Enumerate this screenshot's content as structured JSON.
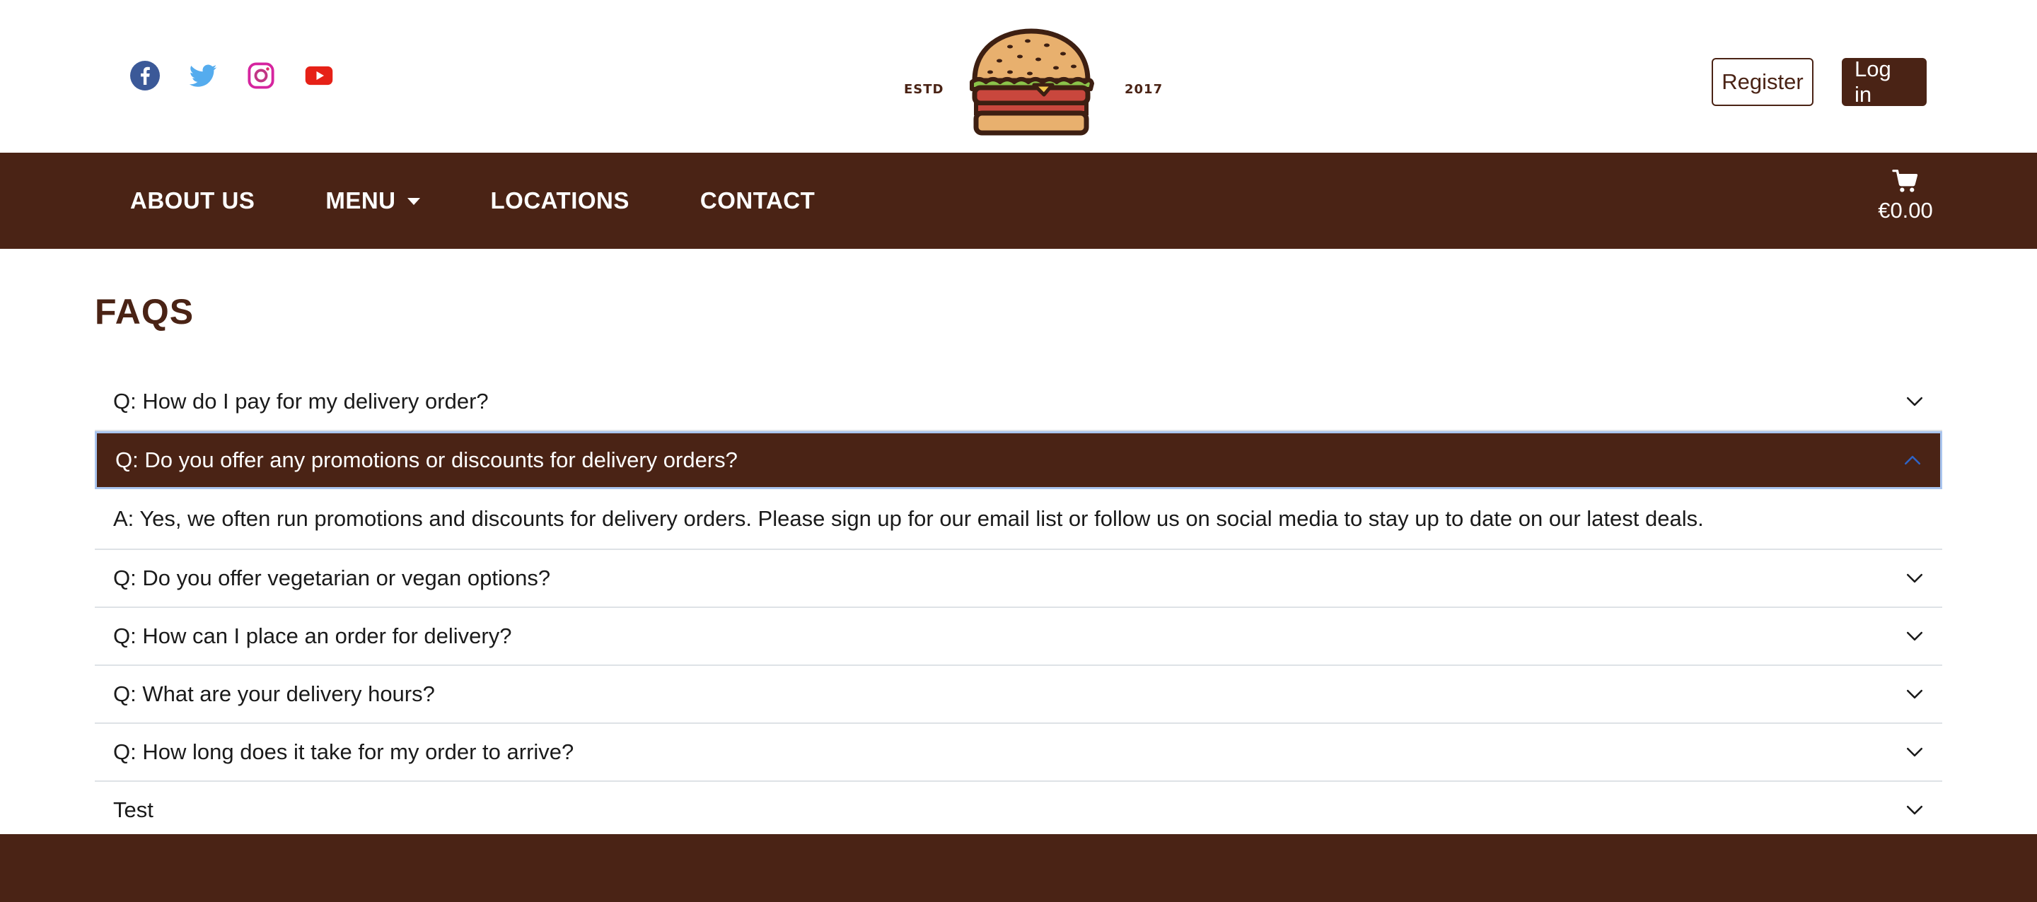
{
  "header": {
    "social": [
      {
        "icon": "facebook-icon",
        "color": "#3b5998"
      },
      {
        "icon": "twitter-icon",
        "color": "#55acee"
      },
      {
        "icon": "instagram-icon",
        "color": "#c13584"
      },
      {
        "icon": "youtube-icon",
        "color": "#e62117"
      }
    ],
    "logo": {
      "left_text": "ESTD",
      "right_text": "2017"
    },
    "register_label": "Register",
    "login_label": "Log in"
  },
  "nav": {
    "items": [
      {
        "label": "ABOUT US"
      },
      {
        "label": "MENU"
      },
      {
        "label": "LOCATIONS"
      },
      {
        "label": "CONTACT"
      }
    ],
    "cart_total": "€0.00"
  },
  "page": {
    "title": "FAQS"
  },
  "faqs": [
    {
      "q": "Q: How do I pay for my delivery order?",
      "expanded": false
    },
    {
      "q": "Q: Do you offer any promotions or discounts for delivery orders?",
      "expanded": true,
      "a": "A: Yes, we often run promotions and discounts for delivery orders. Please sign up for our email list or follow us on social media to stay up to date on our latest deals."
    },
    {
      "q": "Q: Do you offer vegetarian or vegan options?",
      "expanded": false
    },
    {
      "q": "Q: How can I place an order for delivery?",
      "expanded": false
    },
    {
      "q": "Q: What are your delivery hours?",
      "expanded": false
    },
    {
      "q": "Q: How long does it take for my order to arrive?",
      "expanded": false
    },
    {
      "q": "Test",
      "expanded": false
    }
  ],
  "colors": {
    "brand": "#4a2315",
    "accordion_focus": "#a9c4ee"
  }
}
